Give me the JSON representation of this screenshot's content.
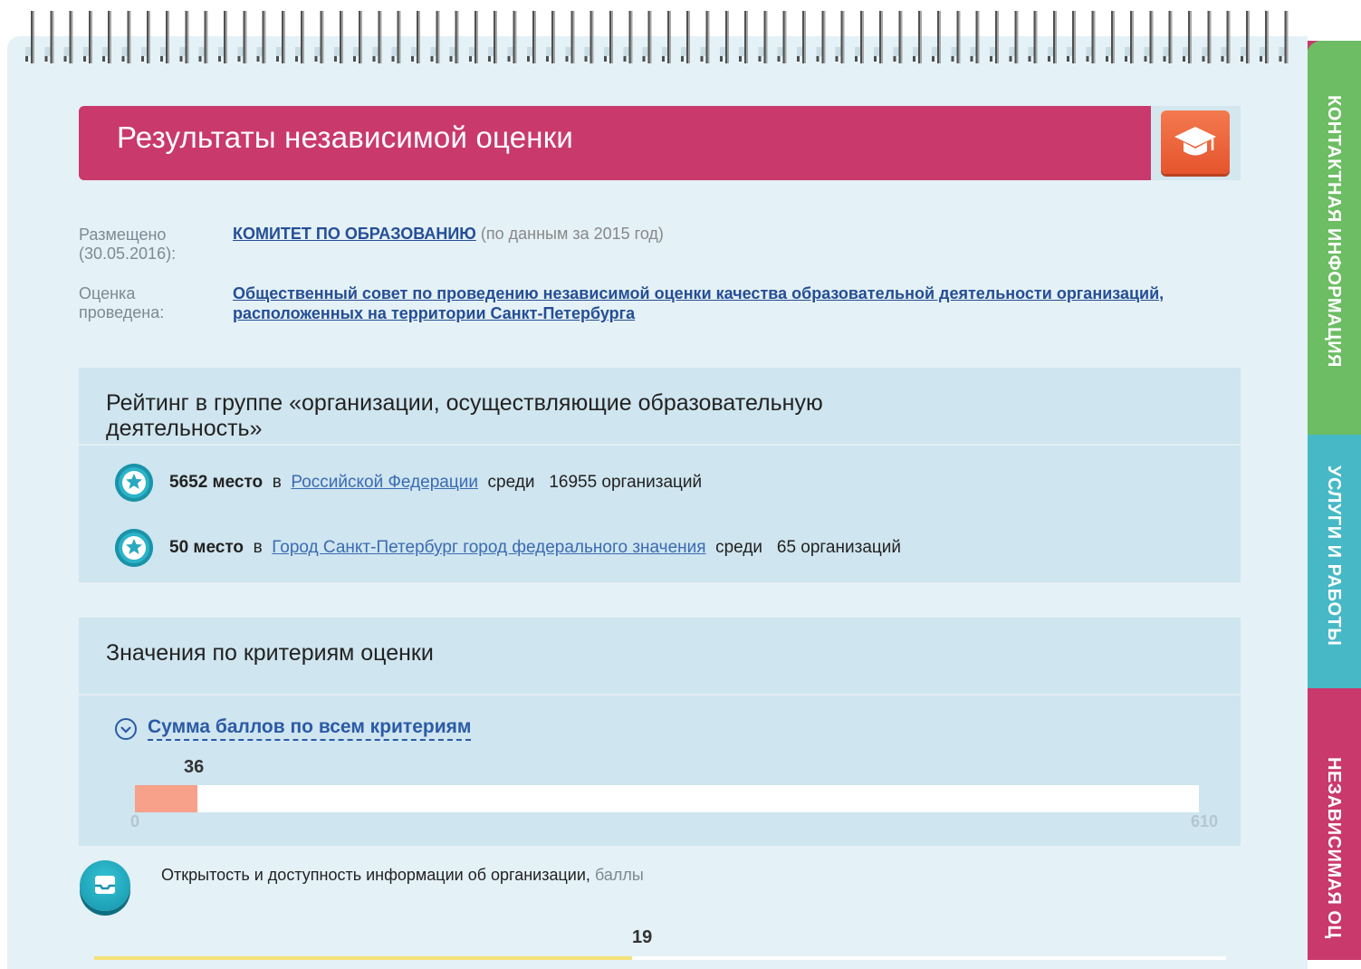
{
  "header": {
    "title": "Результаты независимой оценки",
    "icon": "graduation-cap-icon"
  },
  "meta": {
    "posted_label": "Размещено (30.05.2016):",
    "posted_org": "КОМИТЕТ ПО ОБРАЗОВАНИЮ",
    "posted_note": "(по данным за 2015 год)",
    "evaluated_label": "Оценка проведена:",
    "evaluated_org": "Общественный совет по проведению независимой оценки качества образовательной деятельности организаций, расположенных на территории Санкт-Петербурга"
  },
  "rating": {
    "title": "Рейтинг в группе «организации, осуществляющие образовательную деятельность»",
    "rows": [
      {
        "place": "5652 место",
        "in": "в",
        "region": "Российской Федерации",
        "among": "среди",
        "count": "16955 организаций"
      },
      {
        "place": "50 место",
        "in": "в",
        "region": "Город Санкт-Петербург город федерального значения",
        "among": "среди",
        "count": "65 организаций"
      }
    ]
  },
  "criteria": {
    "title": "Значения по критериям оценки",
    "sum_link": "Сумма баллов по всем критериям",
    "sum_value": "36",
    "sum_min": "0",
    "sum_max": "610",
    "sum_fraction": 0.059,
    "openness_label": "Открытость и доступность информации об организации,",
    "openness_unit": "баллы",
    "openness_value": "19"
  },
  "tabs": {
    "contacts": "КОНТАКТНАЯ ИНФОРМАЦИЯ",
    "services": "УСЛУГИ И РАБОТЫ",
    "independent": "НЕЗАВИСИМАЯ ОЦ"
  },
  "colors": {
    "accent": "#c9396c",
    "tab_green": "#6cbd63",
    "tab_teal": "#47b9c6",
    "bar_fill": "#f7a08a",
    "link": "#254e96"
  }
}
